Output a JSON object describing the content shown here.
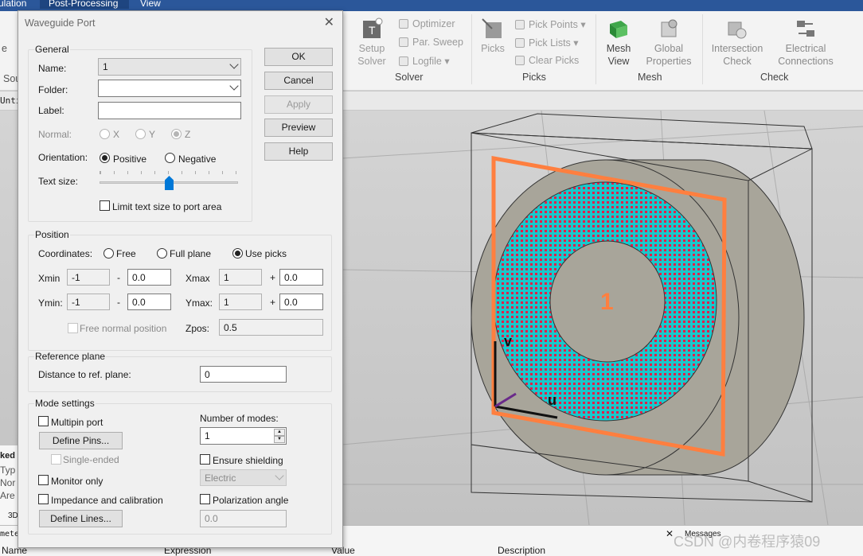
{
  "topbar": {
    "tab_simulation": "ulation",
    "tab_post": "Post-Processing",
    "tab_view": "View"
  },
  "ribbon": {
    "setup_solver": "Setup\nSolver",
    "optimizer": "Optimizer",
    "par_sweep": "Par. Sweep",
    "logfile": "Logfile",
    "solver_group": "Solver",
    "picks": "Picks",
    "pick_points": "Pick Points",
    "pick_lists": "Pick Lists",
    "clear_picks": "Clear Picks",
    "picks_group": "Picks",
    "mesh_view": "Mesh\nView",
    "global_props": "Global\nProperties",
    "mesh_group": "Mesh",
    "intersection_check": "Intersection\nCheck",
    "electrical_connections": "Electrical\nConnections",
    "check_group": "Check",
    "left_fragment": "e",
    "left_fragment2": "Sou"
  },
  "tabstrip": {
    "doc_tab": "Unti"
  },
  "viewport": {
    "port_number": "1",
    "axis_v": "v",
    "axis_u": "u"
  },
  "leftpane": {
    "l1": "ked",
    "l2": "Typ",
    "l3": "Nor",
    "l4": "Are",
    "l5": "3D"
  },
  "bottom": {
    "col_name": "Name",
    "col_expression": "Expression",
    "col_value": "Value",
    "col_description": "Description",
    "messages": "Messages",
    "watermark": "CSDN @内卷程序猿09",
    "frag": "mete"
  },
  "dialog": {
    "title": "Waveguide Port",
    "general": {
      "legend": "General",
      "name_label": "Name:",
      "name_value": "1",
      "folder_label": "Folder:",
      "folder_value": "",
      "label_label": "Label:",
      "label_value": "",
      "normal_label": "Normal:",
      "normal_x": "X",
      "normal_y": "Y",
      "normal_z": "Z",
      "orientation_label": "Orientation:",
      "positive": "Positive",
      "negative": "Negative",
      "textsize_label": "Text size:",
      "limit_label": "Limit text size to port area"
    },
    "buttons": {
      "ok": "OK",
      "cancel": "Cancel",
      "apply": "Apply",
      "preview": "Preview",
      "help": "Help"
    },
    "position": {
      "legend": "Position",
      "coordinates_label": "Coordinates:",
      "free": "Free",
      "full_plane": "Full plane",
      "use_picks": "Use picks",
      "xmin_label": "Xmin",
      "xmin": "-1",
      "xmin_off": "0.0",
      "xmax_label": "Xmax",
      "xmax": "1",
      "xmax_off": "0.0",
      "ymin_label": "Ymin:",
      "ymin": "-1",
      "ymin_off": "0.0",
      "ymax_label": "Ymax:",
      "ymax": "1",
      "ymax_off": "0.0",
      "minus": "-",
      "plus": "+",
      "free_normal": "Free normal position",
      "zpos_label": "Zpos:",
      "zpos": "0.5"
    },
    "reference": {
      "legend": "Reference plane",
      "distance_label": "Distance to ref. plane:",
      "distance": "0"
    },
    "mode": {
      "legend": "Mode settings",
      "multipin": "Multipin port",
      "define_pins": "Define Pins...",
      "single_ended": "Single-ended",
      "monitor_only": "Monitor only",
      "impedance": "Impedance and calibration",
      "define_lines": "Define Lines...",
      "modes_label": "Number of modes:",
      "modes": "1",
      "ensure_shielding": "Ensure shielding",
      "electric": "Electric",
      "polarization": "Polarization angle",
      "polarization_value": "0.0"
    }
  },
  "colors": {
    "port_orange": "#ff7f3f",
    "mesh_red": "#e0204a",
    "mesh_cyan": "#19c8cc",
    "cylinder": "#a8a59a"
  }
}
